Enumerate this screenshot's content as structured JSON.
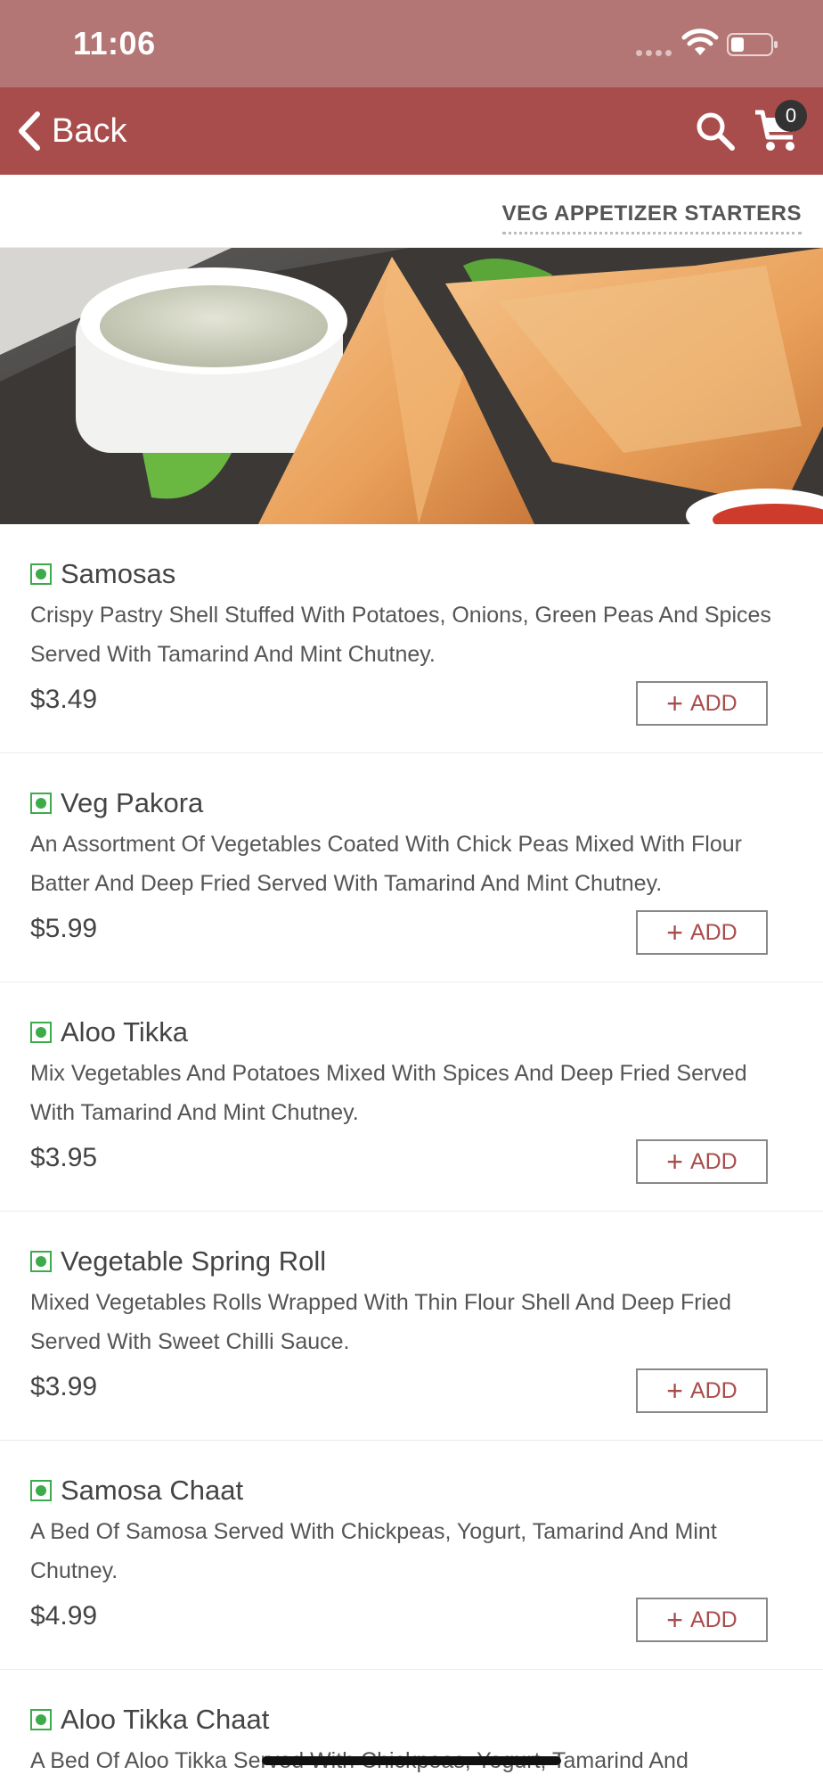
{
  "status_bar": {
    "time": "11:06"
  },
  "nav": {
    "back_label": "Back",
    "cart_count": "0"
  },
  "category": {
    "title": "VEG APPETIZER STARTERS"
  },
  "colors": {
    "nav_bg": "#a94c4c",
    "status_bg": "#b37674",
    "veg_green": "#3cab4a",
    "add_text": "#a94c4c"
  },
  "icons": {
    "back": "chevron-left-icon",
    "search": "search-icon",
    "cart": "cart-icon",
    "veg": "veg-indicator-icon"
  },
  "add_label": "ADD",
  "items": [
    {
      "name": "Samosas",
      "description": "Crispy Pastry Shell Stuffed With Potatoes, Onions, Green Peas And Spices Served With Tamarind And Mint Chutney.",
      "price": "$3.49"
    },
    {
      "name": "Veg Pakora",
      "description": "An Assortment Of Vegetables Coated With Chick Peas Mixed With Flour Batter And Deep Fried Served With Tamarind And Mint Chutney.",
      "price": "$5.99"
    },
    {
      "name": "Aloo Tikka",
      "description": "Mix Vegetables And Potatoes Mixed With Spices And Deep Fried Served With Tamarind And Mint Chutney.",
      "price": "$3.95"
    },
    {
      "name": "Vegetable Spring Roll",
      "description": "Mixed Vegetables Rolls Wrapped With Thin Flour Shell And Deep Fried Served With Sweet Chilli Sauce.",
      "price": "$3.99"
    },
    {
      "name": "Samosa Chaat",
      "description": "A Bed Of Samosa Served With Chickpeas, Yogurt, Tamarind And Mint Chutney.",
      "price": "$4.99"
    },
    {
      "name": "Aloo Tikka Chaat",
      "description": "A Bed Of Aloo Tikka Served With Chickpeas, Yogurt, Tamarind And",
      "price": ""
    }
  ]
}
